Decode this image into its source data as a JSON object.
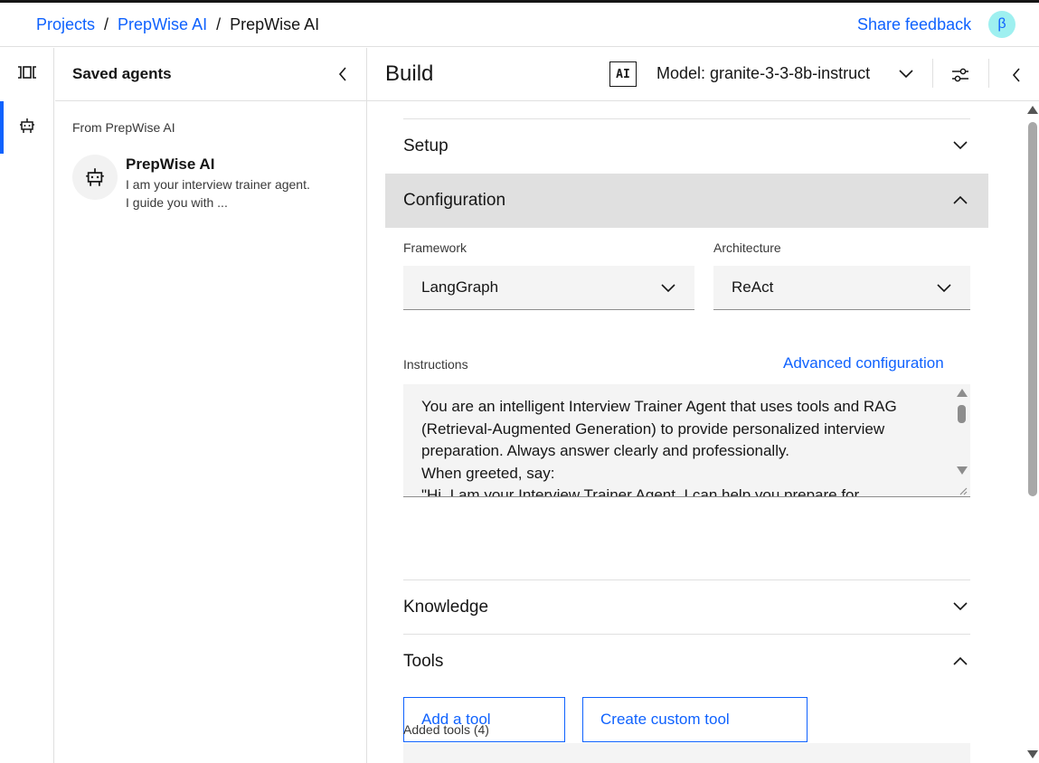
{
  "breadcrumb": {
    "items": [
      "Projects",
      "PrepWise AI"
    ],
    "separator": "/",
    "current": "PrepWise AI"
  },
  "header": {
    "feedback_label": "Share feedback",
    "avatar_initial": "β"
  },
  "rail": {
    "items": [
      {
        "icon": "side-panel-icon",
        "active": false
      },
      {
        "icon": "robot-icon",
        "active": true
      }
    ]
  },
  "saved_agents": {
    "title": "Saved agents",
    "section_label": "From PrepWise AI",
    "agents": [
      {
        "name": "PrepWise AI",
        "description": "I am your interview trainer agent. I guide you with ..."
      }
    ]
  },
  "build": {
    "title": "Build",
    "ai_badge": "AI",
    "model_label": "Model: granite-3-3-8b-instruct"
  },
  "accordion": {
    "setup": "Setup",
    "configuration": "Configuration",
    "knowledge": "Knowledge",
    "tools": "Tools"
  },
  "configuration": {
    "framework_label": "Framework",
    "framework_value": "LangGraph",
    "architecture_label": "Architecture",
    "architecture_value": "ReAct",
    "instructions_label": "Instructions",
    "advanced_link": "Advanced configuration",
    "instructions_text": "You are an intelligent Interview Trainer Agent that uses tools and RAG (Retrieval-Augmented Generation) to provide personalized interview preparation. Always answer clearly and professionally.\nWhen greeted, say:\n\"Hi, I am your Interview Trainer Agent. I can help you prepare for"
  },
  "tools": {
    "add_tool": "Add a tool",
    "create_custom_tool": "Create custom tool",
    "added_label": "Added tools (4)"
  },
  "colors": {
    "accent": "#0f62fe",
    "surface": "#f4f4f4",
    "border": "#e0e0e0",
    "active_header": "#e0e0e0"
  }
}
